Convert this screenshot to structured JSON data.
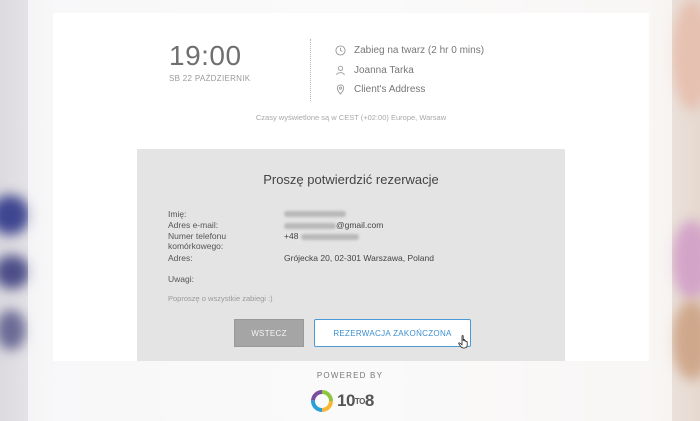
{
  "appointment": {
    "time": "19:00",
    "date": "SB 22 PAŹDZIERNIK",
    "service": "Zabieg na twarz (2 hr 0 mins)",
    "staff": "Joanna Tarka",
    "location": "Client's Address",
    "timezone_note": "Czasy wyświetlone są w CEST (+02:00) Europe, Warsaw"
  },
  "confirmation": {
    "title": "Proszę potwierdzić rezerwacje",
    "labels": {
      "name": "Imię:",
      "email": "Adres e-mail:",
      "phone": "Numer telefonu komórkowego:",
      "address": "Adres:",
      "notes": "Uwagi:"
    },
    "values": {
      "email_domain": "@gmail.com",
      "phone_prefix": "+48",
      "address": "Grójecka 20, 02-301 Warszawa, Poland"
    },
    "note": "Poproszę o wszystkie zabiegi :)"
  },
  "buttons": {
    "back": "WSTECZ",
    "confirm": "REZERWACJA ZAKOŃCZONA"
  },
  "footer": {
    "powered_by": "POWERED BY",
    "brand_main": "10",
    "brand_small": "TO",
    "brand_end": "8"
  },
  "icons": {
    "clock": "clock-icon",
    "person": "person-icon",
    "pin": "map-pin-icon",
    "cursor": "hand-cursor-icon"
  },
  "colors": {
    "accent": "#4a9ad8",
    "back_button": "#a5a5a5"
  }
}
